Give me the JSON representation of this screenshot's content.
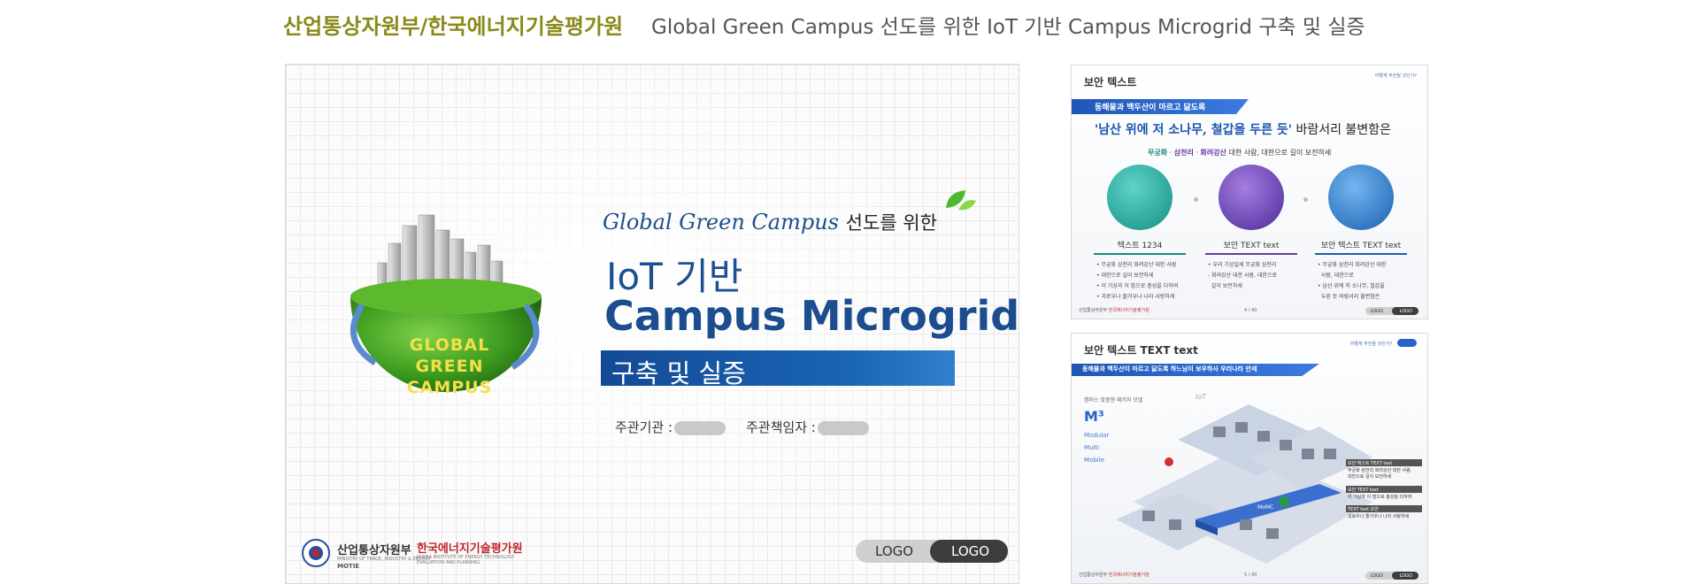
{
  "header": {
    "org": "산업통상자원부/한국에너지기술평가원",
    "title": "Global Green Campus 선도를 위한 IoT 기반 Campus Microgrid 구축 및 실증"
  },
  "main_slide": {
    "globe_text": [
      "GLOBAL",
      "GREEN",
      "CAMPUS"
    ],
    "subtitle_en": "Global Green Campus",
    "subtitle_ko": "선도를 위한",
    "title_line1": "IoT 기반",
    "title_line2": "Campus Microgrid",
    "banner": "구축 및 실증",
    "agency_label": "주관기관 :",
    "manager_label": "주관책임자 :",
    "motie_name": "산업통상자원부",
    "motie_sub": "MINISTRY OF TRADE, INDUSTRY & ENERGY",
    "motie_en": "MOTIE",
    "ketep_name": "한국에너지기술평가원",
    "ketep_sub1": "KOREA INSTITUTE OF ENERGY TECHNOLOGY",
    "ketep_sub2": "EVALUATION AND PLANNING",
    "logo1": "LOGO",
    "logo2": "LOGO"
  },
  "thumb1": {
    "heading": "보안 텍스트",
    "corner": "어떻게 추진될 것인가?",
    "ribbon": "동해물과 백두산이 마르고 닳도록",
    "quote_bold": "'남산 위에 저 소나무, 철갑을 두른 듯'",
    "quote_rest": " 바람서리 불변함은",
    "sub_green": "무궁화",
    "sub_mid": " · ",
    "sub_purple": "삼천리",
    "sub_mid2": " · ",
    "sub_purple2": "화려강산",
    "sub_rest": " 대한 사람, 대한으로 길이 보전하세",
    "columns": [
      {
        "title": "텍스트 1234",
        "color": "#1a8a7a",
        "bullets": [
          "무궁화 삼천리 화려강산 대한 사람",
          "대한으로 길이 보전하세",
          "이 기상과 이 맘으로 충성을 다하여",
          "괴로우나 즐거우나 나라 사랑하세"
        ]
      },
      {
        "title": "보안 TEXT text",
        "color": "#6a3aa8",
        "bullets": [
          "우리 기상일세 무궁화 삼천리",
          "화려강산 대한 사람, 대한으로",
          "길이 보전하세"
        ]
      },
      {
        "title": "보안 텍스트 TEXT text",
        "color": "#1b5fb0",
        "bullets": [
          "무궁화 삼천리 화려강산 대한",
          "사람, 대한으로",
          "남산 위에 저 소나무, 철갑을",
          "두른 듯 바람서리 불변함은"
        ]
      }
    ],
    "page": "4 / 40",
    "logo1": "LOGO",
    "logo2": "LOGO"
  },
  "thumb2": {
    "heading": "보안 텍스트 TEXT text",
    "corner": "어떻게 추진될 것인가?",
    "ribbon": "동해물과 백두산이 마르고 닳도록 하느님이 보우하사 우리나라 만세",
    "side": "캠퍼스 맞춤형 패키지 모델",
    "m3": "M³",
    "mod": [
      "Modular",
      "Multi",
      "Mobile"
    ],
    "iot": "IoT",
    "momc": "MoMC",
    "boxes": [
      {
        "title": "보안 텍스트 TEXT text",
        "desc": [
          "무궁화 삼천리 화려강산 대한 사람,",
          "대한으로 길이 보전하세"
        ]
      },
      {
        "title": "보안 TEXT text",
        "desc": [
          "이 기상과 이 맘으로 충성을 다하여"
        ]
      },
      {
        "title": "TEXT text 보안",
        "desc": [
          "괴로우나 즐거우나 나라 사랑하세"
        ]
      }
    ],
    "page": "5 / 40",
    "logo1": "LOGO",
    "logo2": "LOGO"
  }
}
